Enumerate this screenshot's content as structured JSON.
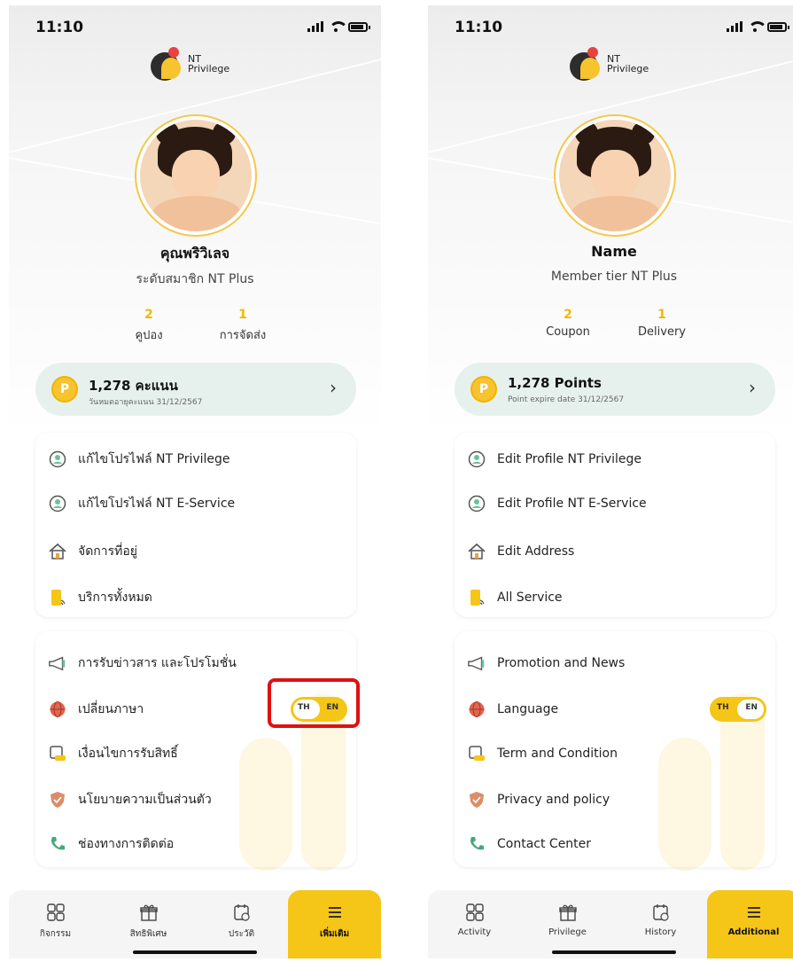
{
  "status": {
    "time": "11:10"
  },
  "logo": {
    "line1": "NT",
    "line2": "Privilege"
  },
  "screens": [
    {
      "lang": "TH",
      "profile": {
        "name": "คุณพริวิเลจ",
        "tier": "ระดับสมาชิก NT Plus"
      },
      "stats": [
        {
          "value": "2",
          "label": "คูปอง"
        },
        {
          "value": "1",
          "label": "การจัดส่ง"
        }
      ],
      "points": {
        "coin": "P",
        "value": "1,278 คะแนน",
        "expire": "วันหมดอายุคะแนน 31/12/2567",
        "arrow": "›"
      },
      "menu1": [
        {
          "label": "แก้ไขโปรไฟล์ NT Privilege",
          "icon": "user-circle-icon"
        },
        {
          "label": "แก้ไขโปรไฟล์ NT E-Service",
          "icon": "user-circle-icon"
        },
        {
          "label": "จัดการที่อยู่",
          "icon": "home-icon"
        },
        {
          "label": "บริการทั้งหมด",
          "icon": "phone-service-icon"
        }
      ],
      "menu2": [
        {
          "label": "การรับข่าวสาร และโปรโมชั่น",
          "icon": "megaphone-icon"
        },
        {
          "label": "เปลี่ยนภาษา",
          "icon": "globe-icon"
        },
        {
          "label": "เงื่อนไขการรับสิทธิ์",
          "icon": "scroll-icon"
        },
        {
          "label": "นโยบายความเป็นส่วนตัว",
          "icon": "shield-icon"
        },
        {
          "label": "ช่องทางการติดต่อ",
          "icon": "phone-icon"
        }
      ],
      "toggle": {
        "th": "TH",
        "en": "EN"
      },
      "tabs": [
        {
          "label": "กิจกรรม",
          "icon": "activity-icon"
        },
        {
          "label": "สิทธิพิเศษ",
          "icon": "gift-icon"
        },
        {
          "label": "ประวัติ",
          "icon": "calendar-icon"
        },
        {
          "label": "เพิ่มเติม",
          "icon": "menu-icon"
        }
      ]
    },
    {
      "lang": "EN",
      "profile": {
        "name": "Name",
        "tier": "Member tier NT Plus"
      },
      "stats": [
        {
          "value": "2",
          "label": "Coupon"
        },
        {
          "value": "1",
          "label": "Delivery"
        }
      ],
      "points": {
        "coin": "P",
        "value": "1,278 Points",
        "expire": "Point expire date 31/12/2567",
        "arrow": "›"
      },
      "menu1": [
        {
          "label": "Edit Profile NT Privilege",
          "icon": "user-circle-icon"
        },
        {
          "label": "Edit Profile NT E-Service",
          "icon": "user-circle-icon"
        },
        {
          "label": "Edit Address",
          "icon": "home-icon"
        },
        {
          "label": "All Service",
          "icon": "phone-service-icon"
        }
      ],
      "menu2": [
        {
          "label": "Promotion and News",
          "icon": "megaphone-icon"
        },
        {
          "label": "Language",
          "icon": "globe-icon"
        },
        {
          "label": "Term and Condition",
          "icon": "scroll-icon"
        },
        {
          "label": "Privacy and policy",
          "icon": "shield-icon"
        },
        {
          "label": "Contact Center",
          "icon": "phone-icon"
        }
      ],
      "toggle": {
        "th": "TH",
        "en": "EN"
      },
      "tabs": [
        {
          "label": "Activity",
          "icon": "activity-icon"
        },
        {
          "label": "Privilege",
          "icon": "gift-icon"
        },
        {
          "label": "History",
          "icon": "calendar-icon"
        },
        {
          "label": "Additional",
          "icon": "menu-icon"
        }
      ]
    }
  ],
  "colors": {
    "accent": "#f5c518",
    "highlight": "#e01010",
    "points_bg": "#e6f1ee"
  }
}
